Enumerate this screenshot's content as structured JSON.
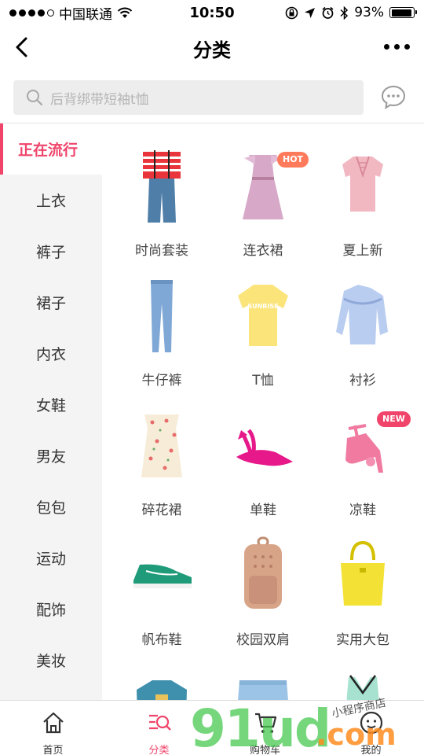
{
  "status_bar": {
    "carrier": "中国联通",
    "time": "10:50",
    "battery_percent": "93%",
    "battery_level": 0.93,
    "signal_bars": 4
  },
  "nav": {
    "title": "分类"
  },
  "search": {
    "placeholder": "后背绑带短袖t恤"
  },
  "sidebar": {
    "items": [
      {
        "label": "正在流行",
        "active": true
      },
      {
        "label": "上衣"
      },
      {
        "label": "裤子"
      },
      {
        "label": "裙子"
      },
      {
        "label": "内衣"
      },
      {
        "label": "女鞋"
      },
      {
        "label": "男友"
      },
      {
        "label": "包包"
      },
      {
        "label": "运动"
      },
      {
        "label": "配饰"
      },
      {
        "label": "美妆"
      }
    ]
  },
  "grid": {
    "items": [
      {
        "label": "时尚套装",
        "icon": "outfit-set-icon"
      },
      {
        "label": "连衣裙",
        "icon": "dress-icon",
        "badge": "HOT"
      },
      {
        "label": "夏上新",
        "icon": "pink-top-icon"
      },
      {
        "label": "牛仔裤",
        "icon": "jeans-icon"
      },
      {
        "label": "T恤",
        "icon": "tshirt-icon"
      },
      {
        "label": "衬衫",
        "icon": "shirt-icon"
      },
      {
        "label": "碎花裙",
        "icon": "floral-dress-icon"
      },
      {
        "label": "单鞋",
        "icon": "flat-shoe-icon"
      },
      {
        "label": "凉鞋",
        "icon": "sandal-icon",
        "badge": "NEW"
      },
      {
        "label": "帆布鞋",
        "icon": "canvas-shoe-icon"
      },
      {
        "label": "校园双肩",
        "icon": "backpack-icon"
      },
      {
        "label": "实用大包",
        "icon": "tote-bag-icon"
      },
      {
        "label": "",
        "icon": "sweatshirt-icon"
      },
      {
        "label": "",
        "icon": "denim-shorts-icon"
      },
      {
        "label": "",
        "icon": "tank-top-icon"
      }
    ],
    "tshirt_print": "SUNRISE"
  },
  "tabbar": {
    "items": [
      {
        "label": "首页",
        "icon": "home-icon"
      },
      {
        "label": "分类",
        "icon": "category-icon",
        "active": true
      },
      {
        "label": "购物车",
        "icon": "cart-icon"
      },
      {
        "label": "我的",
        "icon": "profile-icon"
      }
    ]
  },
  "watermark": {
    "brand": "91ud",
    "domain": ".com",
    "tagline": "小程序商店"
  },
  "colors": {
    "accent": "#f0446a",
    "sidebar_bg": "#f4f4f4",
    "search_bg": "#ededed"
  }
}
